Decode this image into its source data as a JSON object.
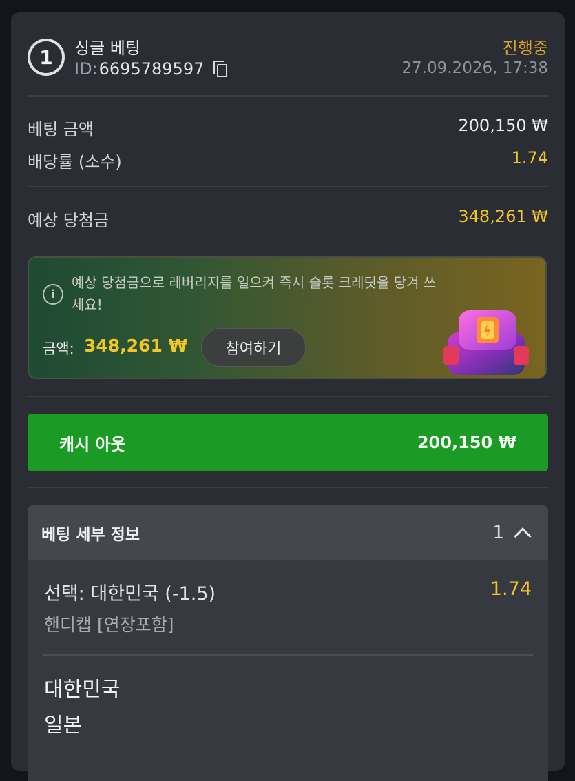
{
  "header": {
    "number": "1",
    "bet_type": "싱글 베팅",
    "id_label": "ID:",
    "id_value": "6695789597",
    "status": "진행중",
    "datetime": "27.09.2026, 17:38"
  },
  "summary": {
    "stake_label": "베팅 금액",
    "stake_value": "200,150 ₩",
    "odds_label": "배당률 (소수)",
    "odds_value": "1.74",
    "potential_label": "예상 당첨금",
    "potential_value": "348,261 ₩"
  },
  "promo": {
    "text": "예상 당첨금으로 레버리지를 일으켜 즉시 슬롯 크레딧을 당겨 쓰세요!",
    "amount_label": "금액:",
    "amount_value": "348,261 ₩",
    "join_label": "참여하기"
  },
  "cashout": {
    "label": "캐시 아웃",
    "value": "200,150 ₩"
  },
  "details": {
    "title": "베팅 세부 정보",
    "count": "1",
    "selection": "선택: 대한민국 (-1.5)",
    "selection_odds": "1.74",
    "market": "핸디캡 [연장포함]",
    "team_home": "대한민국",
    "team_away": "일본"
  },
  "colors": {
    "accent_yellow": "#f1c32c",
    "status_orange": "#e0a429",
    "cashout_green": "#1b9a25",
    "card_bg": "#2a2d33"
  },
  "icons": [
    "copy-icon",
    "info-icon",
    "gift-box-icon",
    "chevron-up-icon"
  ]
}
